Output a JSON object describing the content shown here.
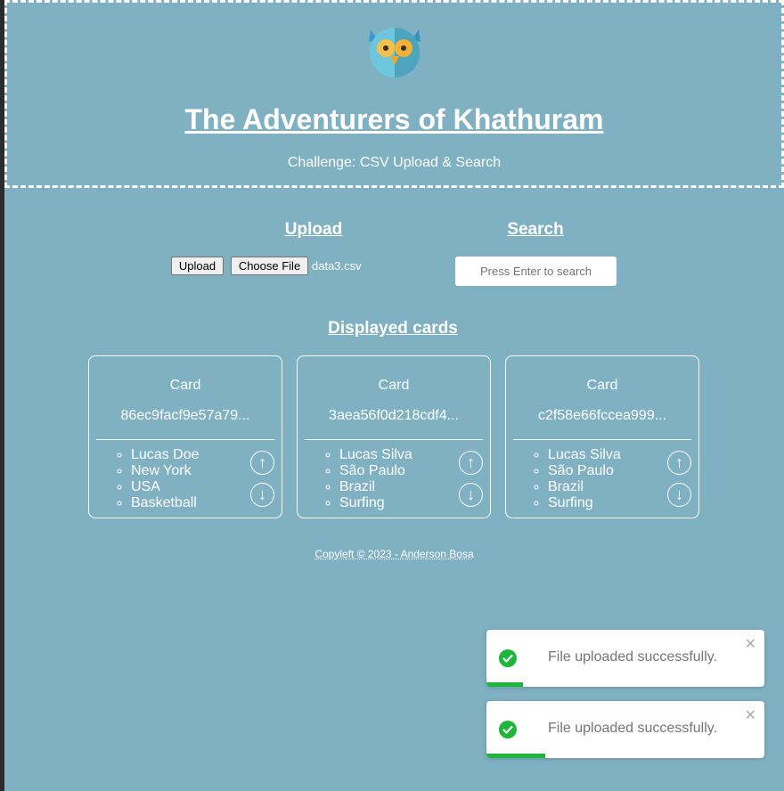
{
  "header": {
    "title": "The Adventurers of Khathuram",
    "subtitle": "Challenge: CSV Upload & Search",
    "logo_icon": "owl-logo-icon"
  },
  "upload": {
    "heading": "Upload",
    "upload_label": "Upload",
    "choose_label": "Choose File",
    "file_name": "data3.csv"
  },
  "search": {
    "heading": "Search",
    "placeholder": "Press Enter to search"
  },
  "cards": {
    "heading": "Displayed cards",
    "items": [
      {
        "label": "Card",
        "id": "86ec9facf9e57a79...",
        "fields": [
          "Lucas Doe",
          "New York",
          "USA",
          "Basketball"
        ]
      },
      {
        "label": "Card",
        "id": "3aea56f0d218cdf4...",
        "fields": [
          "Lucas Silva",
          "São Paulo",
          "Brazil",
          "Surfing"
        ]
      },
      {
        "label": "Card",
        "id": "c2f58e66fccea999...",
        "fields": [
          "Lucas Silva",
          "São Paulo",
          "Brazil",
          "Surfing"
        ]
      }
    ],
    "up_glyph": "↑",
    "down_glyph": "↓"
  },
  "footer": {
    "text": "Copyleft © 2023 - Anderson Bosa"
  },
  "toasts": [
    {
      "message": "File uploaded successfully.",
      "close": "✕",
      "progress": 0.13
    },
    {
      "message": "File uploaded successfully.",
      "close": "✕",
      "progress": 0.21
    }
  ],
  "colors": {
    "background": "#80b1c3",
    "success": "#1db53a",
    "text_light": "#ffffff"
  }
}
